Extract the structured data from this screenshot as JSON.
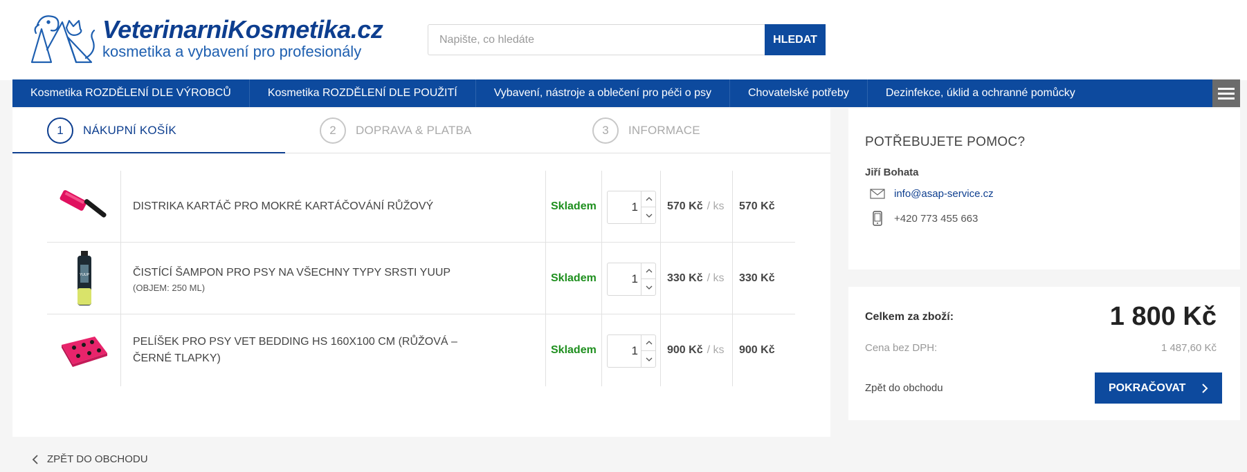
{
  "logo": {
    "title": "VeterinarniKosmetika.cz",
    "subtitle": "kosmetika a vybavení pro profesionály"
  },
  "search": {
    "placeholder": "Napište, co hledáte",
    "value": "",
    "button_label": "HLEDAT"
  },
  "nav": {
    "items": [
      {
        "label": "Kosmetika ROZDĚLENÍ DLE VÝROBCŮ"
      },
      {
        "label": "Kosmetika ROZDĚLENÍ DLE POUŽITÍ"
      },
      {
        "label": "Vybavení, nástroje a oblečení pro péči o psy"
      },
      {
        "label": "Chovatelské potřeby"
      },
      {
        "label": "Dezinfekce, úklid a ochranné pomůcky"
      }
    ],
    "menu_icon": "hamburger-icon"
  },
  "steps": [
    {
      "num": "1",
      "label": "NÁKUPNÍ KOŠÍK",
      "active": true
    },
    {
      "num": "2",
      "label": "DOPRAVA & PLATBA",
      "active": false
    },
    {
      "num": "3",
      "label": "INFORMACE",
      "active": false
    }
  ],
  "cart": {
    "items": [
      {
        "name": "DISTRIKA KARTÁČ PRO MOKRÉ KARTÁČOVÁNÍ RŮŽOVÝ",
        "variant": "",
        "stock": "Skladem",
        "qty": "1",
        "unit_price": "570 Kč",
        "unit": "/ ks",
        "total": "570 Kč",
        "image": "pink-brush"
      },
      {
        "name": "ČISTÍCÍ ŠAMPON PRO PSY NA VŠECHNY TYPY SRSTI YUUP",
        "variant": "(OBJEM: 250 ML)",
        "stock": "Skladem",
        "qty": "1",
        "unit_price": "330 Kč",
        "unit": "/ ks",
        "total": "330 Kč",
        "image": "shampoo-bottle"
      },
      {
        "name": "PELÍŠEK PRO PSY VET BEDDING HS 160X100 CM (RŮŽOVÁ – ČERNÉ TLAPKY)",
        "variant": "",
        "stock": "Skladem",
        "qty": "1",
        "unit_price": "900 Kč",
        "unit": "/ ks",
        "total": "900 Kč",
        "image": "pink-bedding"
      }
    ],
    "stock_color": "#1e8f1e"
  },
  "back_link": "ZPĚT DO OBCHODU",
  "help": {
    "title": "POTŘEBUJETE POMOC?",
    "name": "Jiří Bohata",
    "email": "info@asap-service.cz",
    "phone": "+420 773 455 663"
  },
  "summary": {
    "total_label": "Celkem za zboží:",
    "total_value": "1 800 Kč",
    "nodph_label": "Cena bez DPH:",
    "nodph_value": "1 487,60 Kč",
    "back_label": "Zpět do obchodu",
    "continue_label": "POKRAČOVAT"
  },
  "colors": {
    "brand": "#0d4a9e",
    "brand_dark": "#0d3e8f",
    "success": "#1e8f1e"
  }
}
